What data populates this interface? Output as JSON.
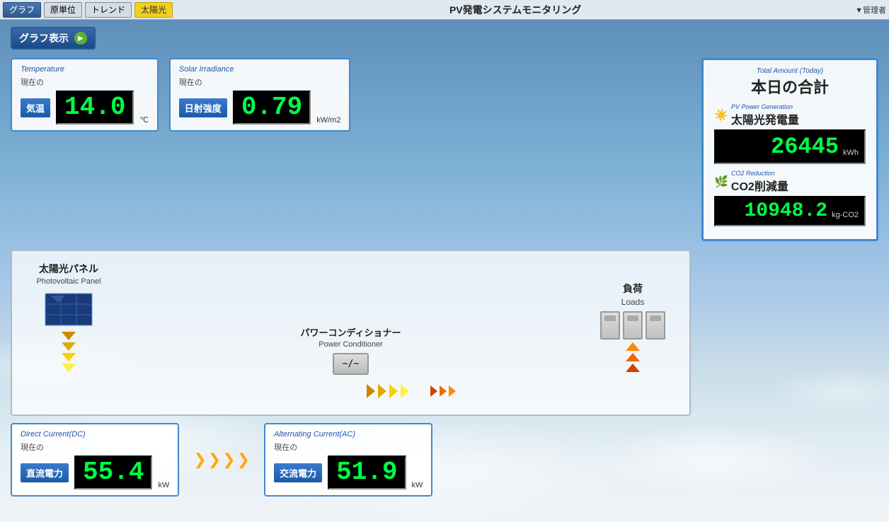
{
  "topbar": {
    "btn_graph": "グラフ",
    "btn_unit": "原単位",
    "btn_trend": "トレンド",
    "btn_solar": "太陽光",
    "title": "PV発電システムモニタリング",
    "menu_label": "▼管理者"
  },
  "graph_display": {
    "label": "グラフ表示"
  },
  "temperature": {
    "card_title": "Temperature",
    "current_label": "現在の",
    "sensor_label": "気温",
    "value": "14.0",
    "unit": "℃"
  },
  "solar_irradiance": {
    "card_title": "Solar Irradiance",
    "current_label": "現在の",
    "sensor_label": "日射強度",
    "value": "0.79",
    "unit": "kW/m2"
  },
  "total_amount": {
    "header": "Total Amount (Today)",
    "title": "本日の合計",
    "pv_section_label": "PV Power Generation",
    "pv_label": "太陽光発電量",
    "pv_value": "26445",
    "pv_unit": "kWh",
    "co2_section_label": "CO2 Reduction",
    "co2_label": "CO2削減量",
    "co2_value": "10948.2",
    "co2_unit": "kg-CO2"
  },
  "pv_panel": {
    "title": "太陽光パネル",
    "subtitle": "Photovoltaic Panel"
  },
  "power_conditioner": {
    "title": "パワーコンディショナー",
    "subtitle": "Power Conditioner",
    "symbol": "~/~"
  },
  "loads": {
    "title": "負荷",
    "subtitle": "Loads"
  },
  "dc": {
    "card_title": "Direct Current(DC)",
    "current_label": "現在の",
    "sensor_label": "直流電力",
    "value": "55.4",
    "unit": "kW"
  },
  "ac": {
    "card_title": "Alternating Current(AC)",
    "current_label": "現在の",
    "sensor_label": "交流電力",
    "value": "51.9",
    "unit": "kW"
  }
}
